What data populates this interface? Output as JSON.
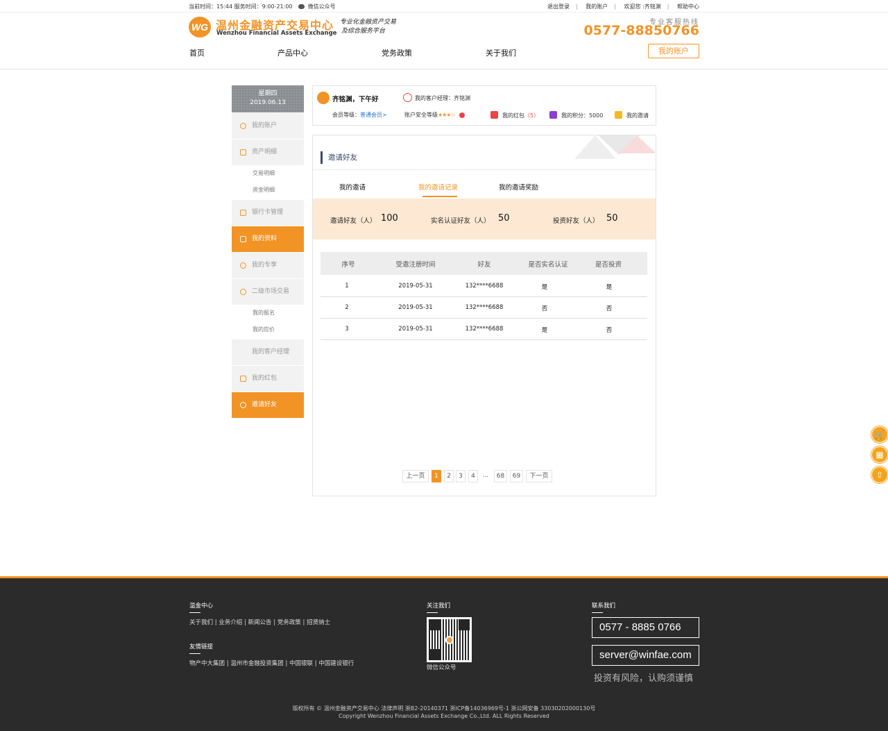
{
  "topbar": {
    "time_text": "当前时间：15:44 服务时间：9:00-21:00",
    "wechat": "微信公众号",
    "links": [
      "退出登录",
      "我的账户",
      "欢迎您 :齐铭渊",
      "帮助中心"
    ]
  },
  "header": {
    "logo_mark": "WG",
    "logo_cn": "温州金融资产交易中心",
    "logo_en": "Wenzhou Financial Assets Exchange",
    "slogan_1": "专业化金融资产交易",
    "slogan_2": "及综合服务平台",
    "hotline_label": "专业客服热线",
    "hotline": "0577-88850766",
    "nav": [
      "首页",
      "产品中心",
      "党务政策",
      "关于我们"
    ],
    "account_button": "我的账户"
  },
  "sidebar": {
    "weekday": "星期四",
    "date": "2019.06.13",
    "items": {
      "account": "我的账户",
      "assets": "资产明细",
      "trade_detail": "交易明细",
      "fund_detail": "资金明细",
      "bank_card": "银行卡管理",
      "profile": "我的资料",
      "exclusive": "我的专享",
      "secondary": "二级市场交易",
      "my_signup": "我的报名",
      "my_quote": "我的应价",
      "manager": "我的客户经理",
      "redpacket": "我的红包",
      "invite": "邀请好友"
    }
  },
  "user": {
    "greeting": "齐铭渊，下午好",
    "manager": "我的客户经理：齐铭渊",
    "level_label": "会员等级：",
    "level_value": "普通会员>",
    "security_label": "账户安全等级",
    "security_stars": "★★★☆",
    "redpacket_label": "我的红包",
    "redpacket_count": "（5）",
    "points": "我的积分：5000",
    "invite": "我的邀请"
  },
  "panel": {
    "title": "邀请好友",
    "tabs": [
      "我的邀请",
      "我的邀请记录",
      "我的邀请奖励"
    ],
    "stats": [
      {
        "label": "邀请好友（人）",
        "value": "100"
      },
      {
        "label": "实名认证好友（人）",
        "value": "50"
      },
      {
        "label": "投资好友（人）",
        "value": "50"
      }
    ],
    "table": {
      "headers": [
        "序号",
        "受邀注册时间",
        "好友",
        "是否实名认证",
        "是否投资"
      ],
      "rows": [
        [
          "1",
          "2019-05-31",
          "132****6688",
          "是",
          "是"
        ],
        [
          "2",
          "2019-05-31",
          "132****6688",
          "否",
          "否"
        ],
        [
          "3",
          "2019-05-31",
          "132****6688",
          "是",
          "否"
        ]
      ]
    },
    "pagination": {
      "prev": "上一页",
      "pages": [
        "1",
        "2",
        "3",
        "4",
        "...",
        "68",
        "69"
      ],
      "next": "下一页"
    }
  },
  "footer": {
    "about_head": "温金中心",
    "about_links": "关于我们 | 业务介绍 | 新闻公告 | 党务政策 | 招贤纳士",
    "friend_head": "友情链接",
    "friend_links": "物产中大集团 | 温州市金融投资集团 | 中国银联 | 中国建设银行",
    "follow_head": "关注我们",
    "qr_caption": "微信公众号",
    "contact_head": "联系我们",
    "phone": "0577 - 8885 0766",
    "email": "server@winfae.com",
    "risk": "投资有风险，认购须谨慎",
    "copyright_1": "版权所有 © 温州金融资产交易中心 法律声明 浙B2-20140371 浙ICP备14036969号-1 浙公网安备 33030202000130号",
    "copyright_2": "Copyright Wenzhou Financial Assets Exchange Co.,Ltd. ALL Rights Reserved"
  },
  "colors": {
    "accent": "#f29325",
    "stats_bg": "#fde9d3",
    "footer_bg": "#2b2b2b"
  }
}
